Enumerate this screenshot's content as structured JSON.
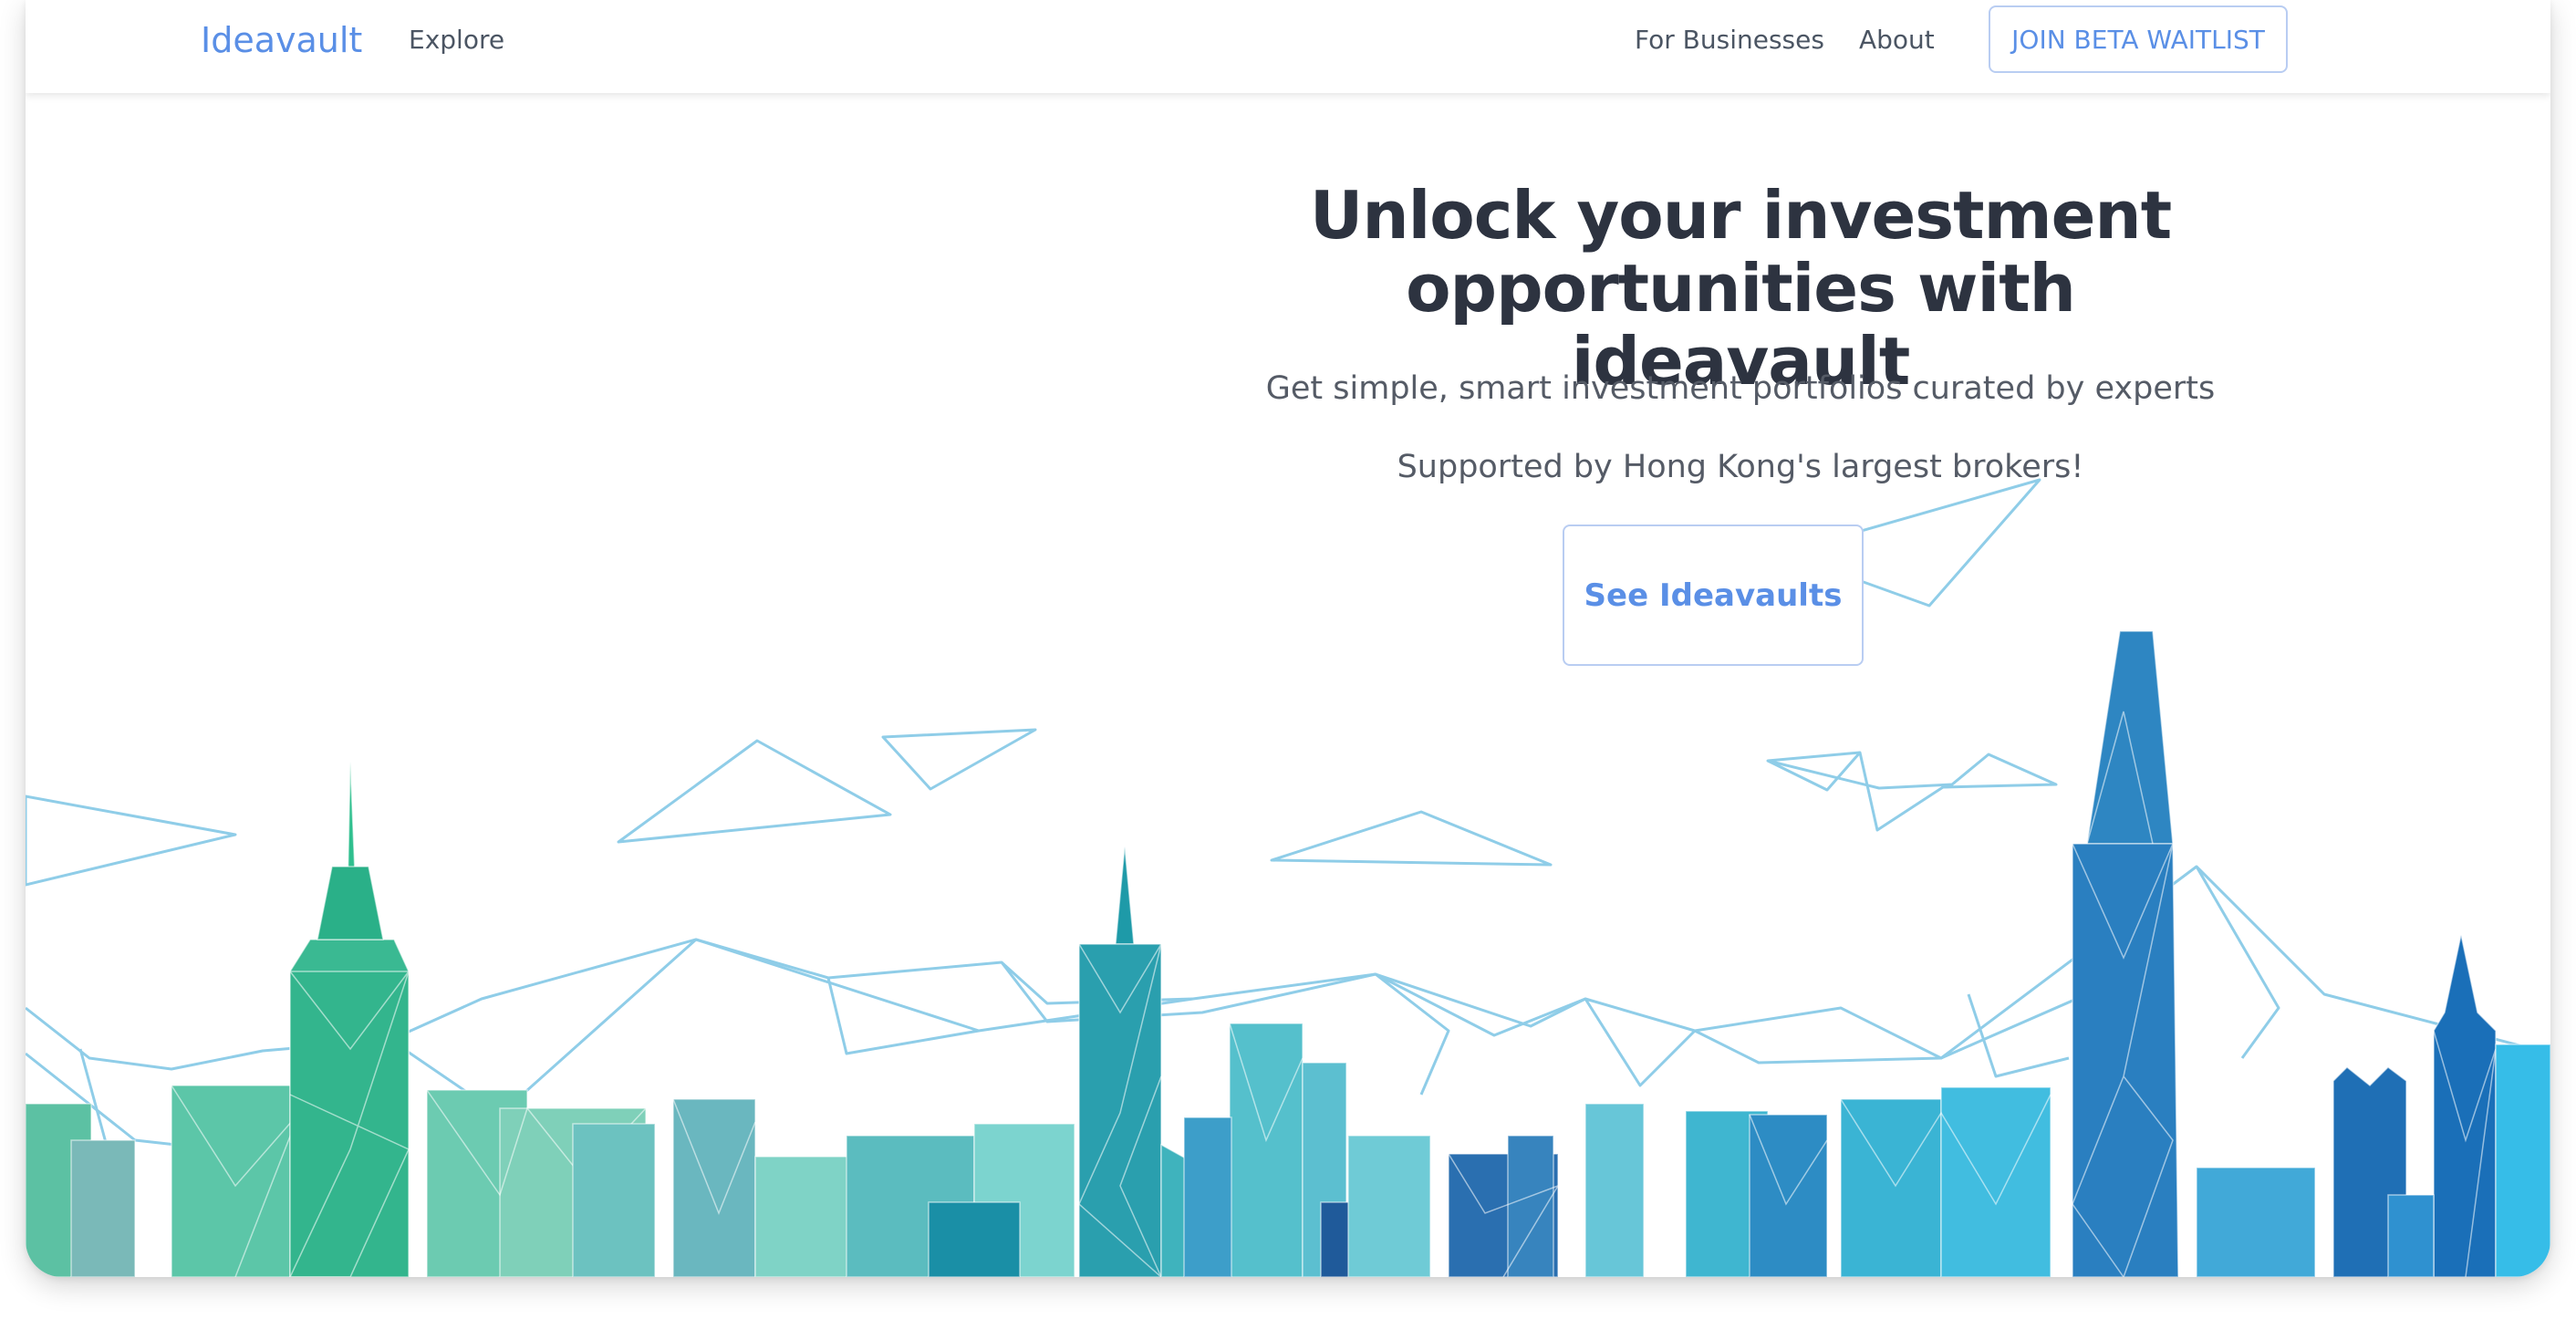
{
  "navbar": {
    "brand": "Ideavault",
    "explore_label": "Explore",
    "businesses_label": "For Businesses",
    "about_label": "About",
    "waitlist_label": "JOIN BETA WAITLIST"
  },
  "hero": {
    "title": "Unlock your investment opportunities with ideavault",
    "subtitle": "Get simple, smart investment portfolios curated by experts",
    "support": "Supported by Hong Kong's largest brokers!",
    "cta_label": "See Ideavaults"
  },
  "colors": {
    "accent": "#5a8fe6",
    "heading": "#2d3340",
    "body_text": "#555b66",
    "button_border": "#b9cdf2",
    "line_art": "#8fcde8",
    "skyline_green": "#3dbf95",
    "skyline_teal": "#5bc3c7",
    "skyline_blue": "#2a7fc0"
  }
}
